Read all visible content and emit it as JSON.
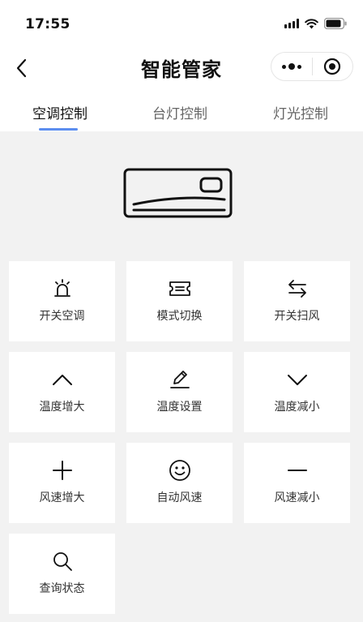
{
  "status_bar": {
    "time": "17:55"
  },
  "nav": {
    "title": "智能管家"
  },
  "tabs": [
    {
      "label": "空调控制",
      "active": true
    },
    {
      "label": "台灯控制",
      "active": false
    },
    {
      "label": "灯光控制",
      "active": false
    }
  ],
  "colors": {
    "accent": "#5b8def",
    "background": "#f2f2f2",
    "tile": "#ffffff"
  },
  "controls": [
    {
      "label": "开关空调",
      "icon": "alarm-light-icon"
    },
    {
      "label": "模式切换",
      "icon": "ticket-icon"
    },
    {
      "label": "开关扫风",
      "icon": "swap-arrows-icon"
    },
    {
      "label": "温度增大",
      "icon": "chevron-up-icon"
    },
    {
      "label": "温度设置",
      "icon": "edit-pencil-icon"
    },
    {
      "label": "温度减小",
      "icon": "chevron-down-icon"
    },
    {
      "label": "风速增大",
      "icon": "plus-icon"
    },
    {
      "label": "自动风速",
      "icon": "smiley-icon"
    },
    {
      "label": "风速减小",
      "icon": "minus-icon"
    },
    {
      "label": "查询状态",
      "icon": "search-icon"
    }
  ]
}
